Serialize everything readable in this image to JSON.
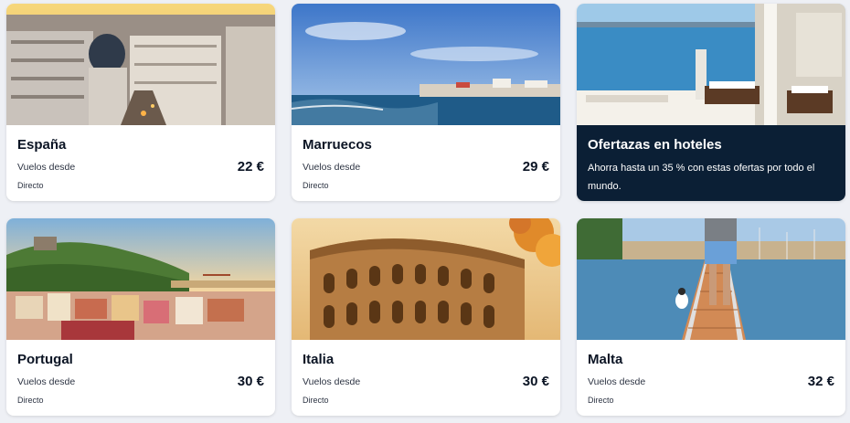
{
  "cards": [
    {
      "title": "España",
      "subtitle": "Vuelos desde",
      "price": "22 €",
      "note": "Directo"
    },
    {
      "title": "Marruecos",
      "subtitle": "Vuelos desde",
      "price": "29 €",
      "note": "Directo"
    },
    {
      "title": "Portugal",
      "subtitle": "Vuelos desde",
      "price": "30 €",
      "note": "Directo"
    },
    {
      "title": "Italia",
      "subtitle": "Vuelos desde",
      "price": "30 €",
      "note": "Directo"
    },
    {
      "title": "Malta",
      "subtitle": "Vuelos desde",
      "price": "32 €",
      "note": "Directo"
    }
  ],
  "promo": {
    "title": "Ofertazas en hoteles",
    "description": "Ahorra hasta un 35 % con estas ofertas por todo el mundo."
  },
  "colors": {
    "promo_background": "#0b1f35",
    "page_background": "#eef0f5",
    "text_dark": "#0b1424"
  }
}
